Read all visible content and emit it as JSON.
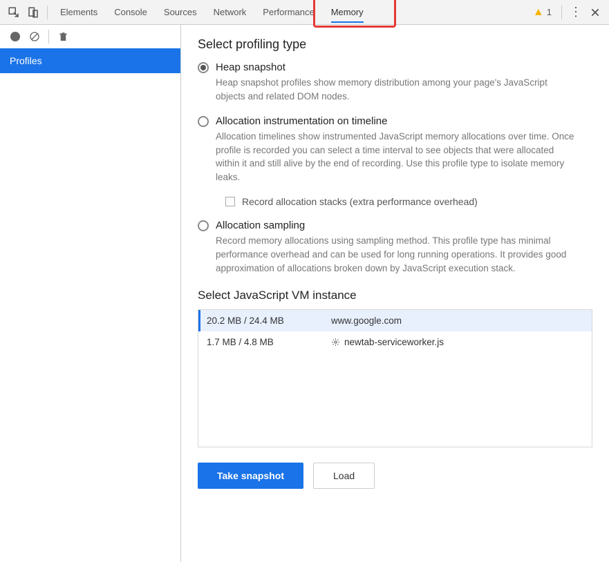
{
  "tabs": {
    "elements": "Elements",
    "console": "Console",
    "sources": "Sources",
    "network": "Network",
    "performance": "Performance",
    "memory": "Memory"
  },
  "warning_count": "1",
  "sidebar": {
    "profiles": "Profiles"
  },
  "main": {
    "select_profiling_type": "Select profiling type",
    "heap_snapshot": {
      "label": "Heap snapshot",
      "desc": "Heap snapshot profiles show memory distribution among your page's JavaScript objects and related DOM nodes."
    },
    "allocation_timeline": {
      "label": "Allocation instrumentation on timeline",
      "desc": "Allocation timelines show instrumented JavaScript memory allocations over time. Once profile is recorded you can select a time interval to see objects that were allocated within it and still alive by the end of recording. Use this profile type to isolate memory leaks.",
      "checkbox": "Record allocation stacks (extra performance overhead)"
    },
    "allocation_sampling": {
      "label": "Allocation sampling",
      "desc": "Record memory allocations using sampling method. This profile type has minimal performance overhead and can be used for long running operations. It provides good approximation of allocations broken down by JavaScript execution stack."
    },
    "vm_section_title": "Select JavaScript VM instance",
    "vm_instances": [
      {
        "size": "20.2 MB / 24.4 MB",
        "name": "www.google.com",
        "has_gear": false
      },
      {
        "size": "1.7 MB / 4.8 MB",
        "name": "newtab-serviceworker.js",
        "has_gear": true
      }
    ],
    "take_snapshot": "Take snapshot",
    "load": "Load"
  }
}
